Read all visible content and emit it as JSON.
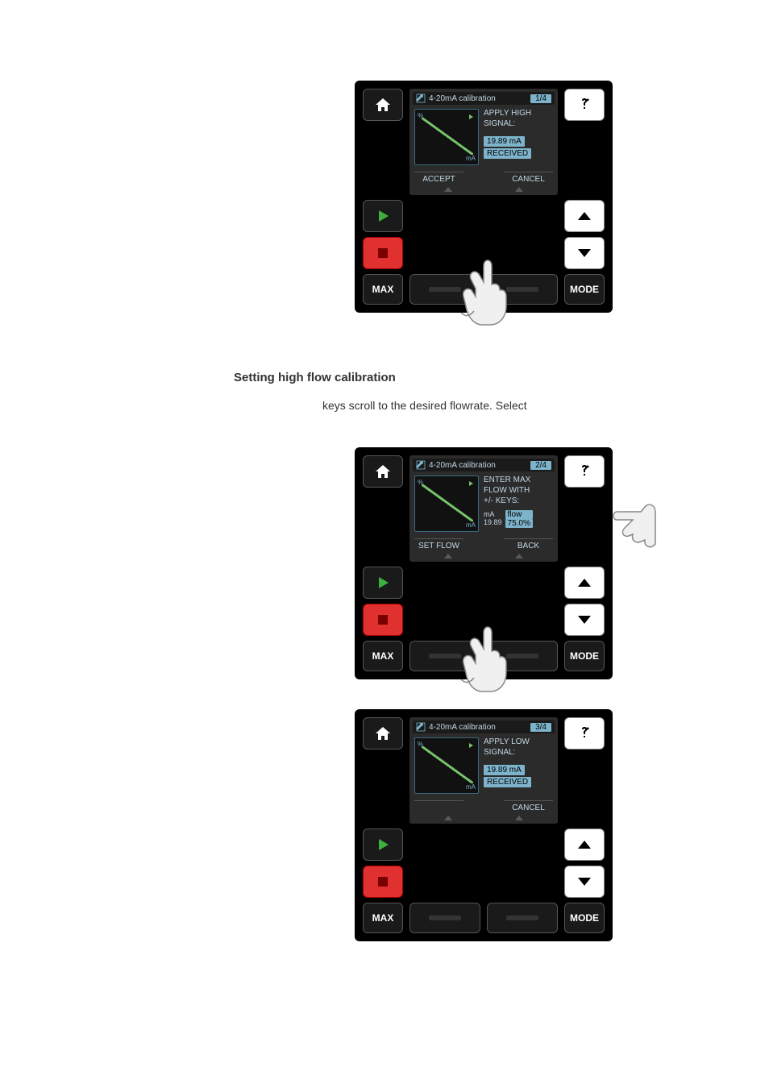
{
  "heading": "Setting high flow calibration",
  "paragraph": "keys scroll to the desired flowrate. Select",
  "devices": [
    {
      "title": "4-20mA calibration",
      "step": "1/4",
      "graph_y": "%",
      "graph_x": "mA",
      "line1": "APPLY HIGH",
      "line2": "SIGNAL:",
      "value": "19.89 mA",
      "received": "RECEIVED",
      "soft_left": "ACCEPT",
      "soft_right": "CANCEL",
      "max_label": "MAX",
      "mode_label": "MODE"
    },
    {
      "title": "4-20mA calibration",
      "step": "2/4",
      "graph_y": "%",
      "graph_x": "mA",
      "line1": "ENTER MAX",
      "line2": "FLOW WITH",
      "line3": "+/- KEYS:",
      "col1_h": "mA",
      "col1_v": "19.89",
      "col2_h": "flow",
      "col2_v": "75.0%",
      "soft_left": "SET FLOW",
      "soft_right": "BACK",
      "max_label": "MAX",
      "mode_label": "MODE"
    },
    {
      "title": "4-20mA calibration",
      "step": "3/4",
      "graph_y": "%",
      "graph_x": "mA",
      "line1": "APPLY LOW",
      "line2": "SIGNAL:",
      "value": "19.89 mA",
      "received": "RECEIVED",
      "soft_left": "",
      "soft_right": "CANCEL",
      "max_label": "MAX",
      "mode_label": "MODE"
    }
  ]
}
